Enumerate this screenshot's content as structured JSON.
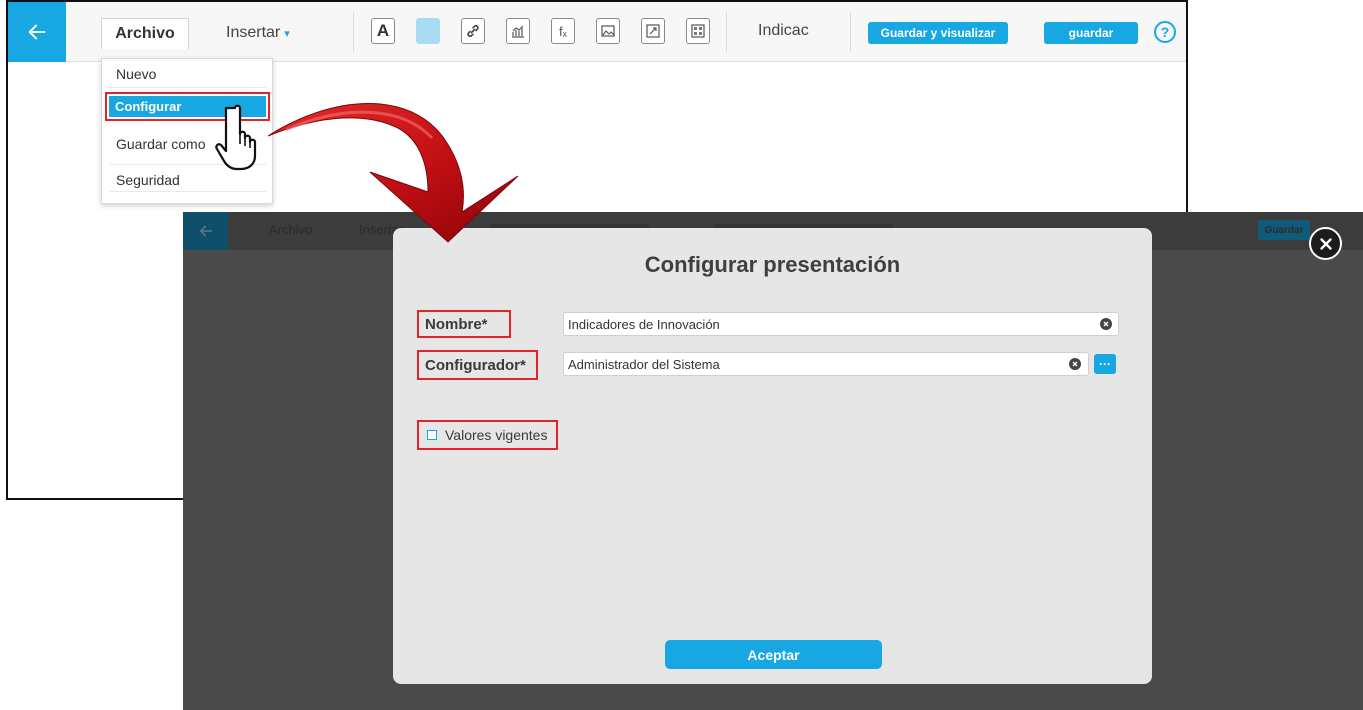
{
  "back_window": {
    "menu": {
      "archivo": "Archivo",
      "insertar": "Insertar",
      "insertar_caret": "▾"
    },
    "toolbar": {
      "font_icon": "A",
      "function_icon": "fₓ"
    },
    "doc_title": "Indicac",
    "buttons": {
      "save_view": "Guardar y visualizar",
      "save": "guardar",
      "help": "?"
    },
    "dropdown": {
      "items": [
        {
          "label": "Nuevo"
        },
        {
          "label": "Configurar",
          "active": true
        },
        {
          "label": "Guardar como"
        },
        {
          "label": "Seguridad"
        }
      ]
    }
  },
  "front_window": {
    "background_menu": {
      "archivo": "Archivo",
      "insertar": "Insertar",
      "guardar": "Guardar"
    },
    "dialog": {
      "title": "Configurar presentación",
      "fields": {
        "nombre": {
          "label": "Nombre*",
          "value": "Indicadores de Innovación"
        },
        "configurador": {
          "label": "Configurador*",
          "value": "Administrador del Sistema",
          "lookup_label": "···"
        }
      },
      "checkbox": {
        "label": "Valores vigentes",
        "checked": false
      },
      "accept_button": "Aceptar"
    }
  },
  "colors": {
    "accent": "#17a8e3",
    "highlight": "#e0242b",
    "dialog_bg": "#e6e6e6",
    "overlay_bg": "#4a4a4a"
  },
  "icons": [
    "back-arrow-icon",
    "text-format-icon",
    "color-swatch-icon",
    "link-icon",
    "chart-icon",
    "function-icon",
    "image-icon",
    "resize-icon",
    "grid-icon",
    "help-icon",
    "pointer-hand-icon",
    "clear-icon",
    "close-icon",
    "curved-arrow-icon"
  ]
}
